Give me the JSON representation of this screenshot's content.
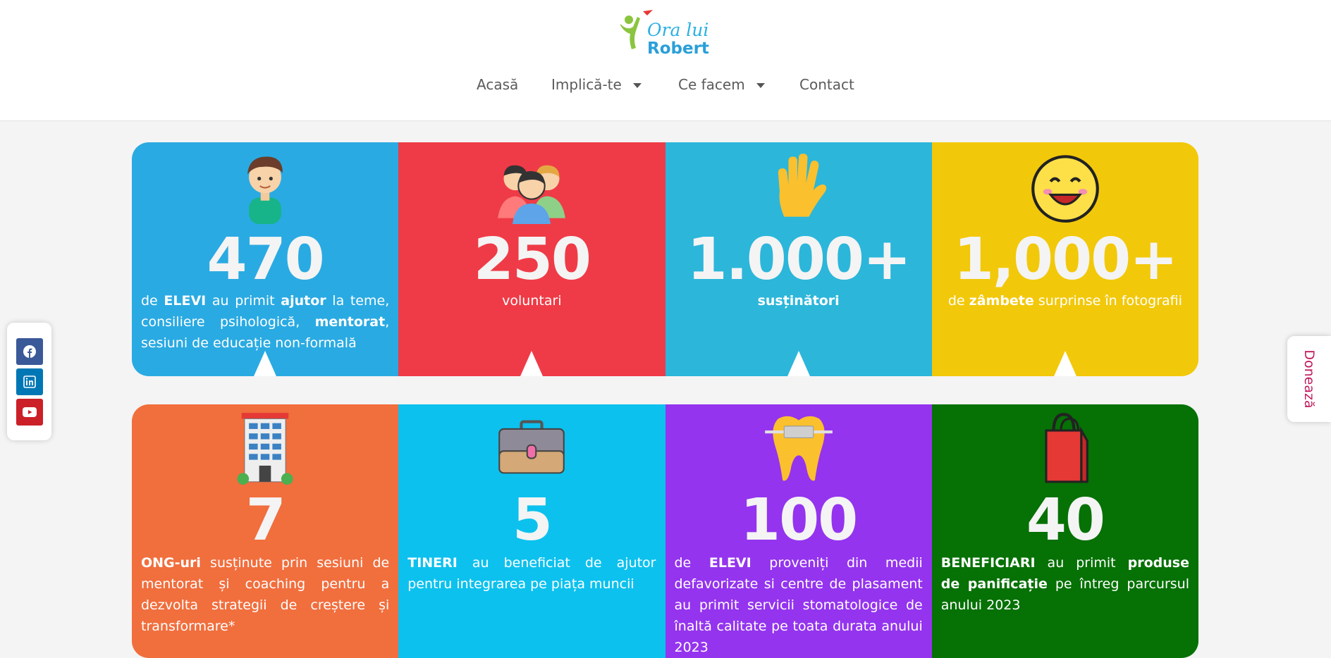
{
  "header": {
    "logo": {
      "line1": "Ora lui",
      "line2": "Robert"
    },
    "nav": [
      {
        "label": "Acasă",
        "has_dropdown": false
      },
      {
        "label": "Implică-te",
        "has_dropdown": true
      },
      {
        "label": "Ce facem",
        "has_dropdown": true
      },
      {
        "label": "Contact",
        "has_dropdown": false
      }
    ]
  },
  "stats_row1": [
    {
      "number": "470",
      "icon": "boy-icon",
      "color": "#2aaae2",
      "segments": [
        [
          "de ",
          false
        ],
        [
          "ELEVI",
          true
        ],
        [
          " au primit ",
          false
        ],
        [
          "ajutor",
          true
        ],
        [
          " la teme, consiliere psihologică, ",
          false
        ],
        [
          "mentorat",
          true
        ],
        [
          ", sesiuni de educație non-formală",
          false
        ]
      ]
    },
    {
      "number": "250",
      "icon": "volunteers-group-icon",
      "color": "#ef3b47",
      "segments": [
        [
          "voluntari",
          false
        ]
      ]
    },
    {
      "number": "1.000+",
      "icon": "raised-hand-icon",
      "color": "#2cb6da",
      "segments": [
        [
          "susținători",
          true
        ]
      ]
    },
    {
      "number": "1,000+",
      "icon": "smiley-face-icon",
      "color": "#f2c80a",
      "segments": [
        [
          "de ",
          false
        ],
        [
          "zâmbete",
          true
        ],
        [
          " surprinse în fotografii",
          false
        ]
      ]
    }
  ],
  "stats_row2": [
    {
      "number": "7",
      "icon": "building-icon",
      "color": "#f16e3d",
      "segments": [
        [
          "ONG-uri",
          true
        ],
        [
          " susținute prin sesiuni de mentorat și coaching pentru a dezvolta strategii de creștere și transformare*",
          false
        ]
      ]
    },
    {
      "number": "5",
      "icon": "briefcase-icon",
      "color": "#0cc1ee",
      "segments": [
        [
          "TINERI",
          true
        ],
        [
          " au beneficiat de ajutor pentru integrarea pe piața muncii",
          false
        ]
      ]
    },
    {
      "number": "100",
      "icon": "tooth-braces-icon",
      "color": "#9434ee",
      "segments": [
        [
          "de ",
          false
        ],
        [
          "ELEVI",
          true
        ],
        [
          " proveniți din medii defavorizate si centre de plasament au primit servicii stomatologice de înaltă calitate pe toata durata anului 2023",
          false
        ]
      ]
    },
    {
      "number": "40",
      "icon": "shopping-bag-icon",
      "color": "#067105",
      "segments": [
        [
          "BENEFICIARI",
          true
        ],
        [
          " au primit ",
          false
        ],
        [
          "produse de panificație",
          true
        ],
        [
          " pe întreg parcursul anului 2023",
          false
        ]
      ]
    }
  ],
  "social": [
    {
      "name": "facebook",
      "icon": "facebook-icon",
      "color": "#3b5998"
    },
    {
      "name": "linkedin",
      "icon": "linkedin-icon",
      "color": "#0077b5"
    },
    {
      "name": "youtube",
      "icon": "youtube-icon",
      "color": "#cb2027"
    }
  ],
  "donate": {
    "label": "Donează"
  }
}
